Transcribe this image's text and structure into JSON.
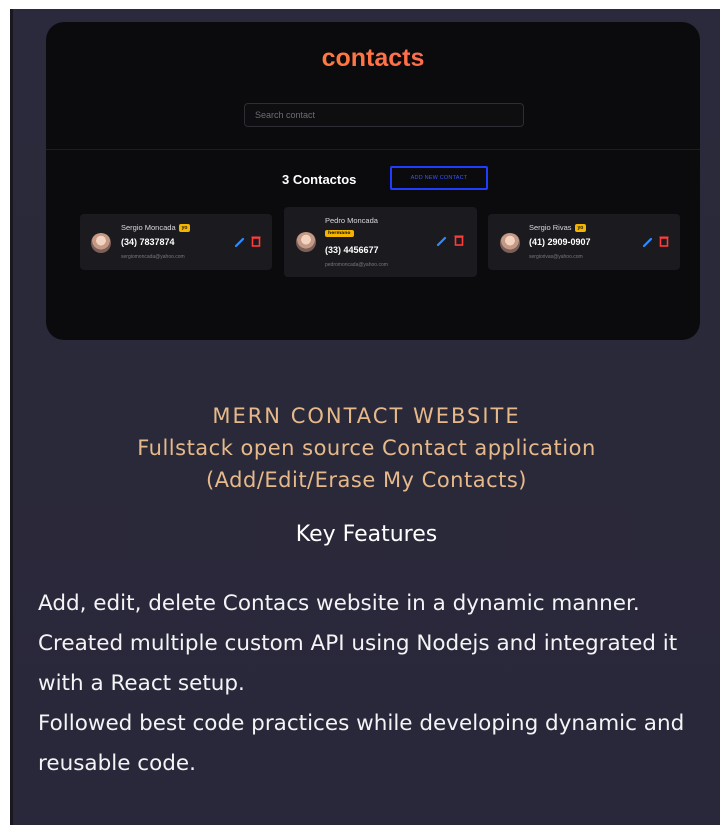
{
  "app": {
    "logo": "contacts",
    "search_placeholder": "Search contact",
    "count_label": "3 Contactos",
    "add_button_label": "ADD NEW CONTACT"
  },
  "contacts": [
    {
      "name": "Sergio Moncada",
      "badge": "yo",
      "phone": "(34) 7837874",
      "email": "sergiomoncada@yahoo.com"
    },
    {
      "name": "Pedro Moncada",
      "badge": "hermano",
      "phone": "(33) 4456677",
      "email": "pedromoncada@yahoo.com"
    },
    {
      "name": "Sergio Rivas",
      "badge": "yo",
      "phone": "(41) 2909-0907",
      "email": "sergiorivas@yahoo.com"
    }
  ],
  "project": {
    "title": "MERN CONTACT WEBSITE",
    "subtitle": "Fullstack open source Contact application",
    "subtitle2": "(Add/Edit/Erase My Contacts)",
    "features_heading": "Key Features",
    "features": [
      "Add, edit, delete Contacs website in a dynamic manner.",
      "Created multiple custom API using Nodejs and integrated it with a React setup.",
      "Followed best code practices while developing dynamic and reusable code."
    ]
  },
  "colors": {
    "accent_blue": "#1f3cff",
    "badge_yellow": "#f4b400",
    "title_gold": "#e6b98a",
    "edit_blue": "#2d8cff",
    "delete_red": "#ff3b3b"
  }
}
